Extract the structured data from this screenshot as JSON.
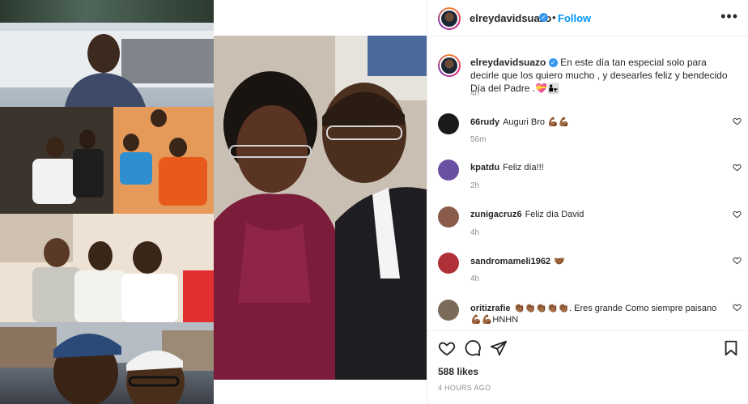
{
  "header": {
    "username": "elreydavidsuazo",
    "verified_badge": "✓",
    "separator": "•",
    "follow_label": "Follow",
    "more_icon": "•••"
  },
  "caption": {
    "username": "elreydavidsuazo",
    "text": "En este día tan especial solo para decirle que los quiero mucho , y desearles feliz y bendecido Día del Padre .💝👨‍👧",
    "time": "4h"
  },
  "comments": [
    {
      "username": "66rudy",
      "text": "Auguri Bro 💪🏾💪🏾",
      "time": "56m",
      "avatar_color": "#1a1a1a"
    },
    {
      "username": "kpatdu",
      "text": "Feliz día!!!",
      "time": "2h",
      "avatar_color": "#6b4fa3"
    },
    {
      "username": "zunigacruz6",
      "text": "Feliz día David",
      "time": "4h",
      "avatar_color": "#8a5a4a"
    },
    {
      "username": "sandromameli1962",
      "text": "🤝🏾",
      "time": "4h",
      "avatar_color": "#b0303a"
    },
    {
      "username": "oritizrafie",
      "text": "👏🏾👏🏾👏🏾👏🏾👏🏾. Eres grande Como siempre paisano 💪🏾💪🏾HNHN",
      "time": "",
      "avatar_color": "#7a6a5a"
    }
  ],
  "actions": {
    "likes": "588 likes",
    "post_time": "4 HOURS AGO"
  },
  "icons": {
    "like": "heart-icon",
    "comment": "comment-bubble-icon",
    "share": "paper-plane-icon",
    "save": "bookmark-icon",
    "comment_like": "small-heart-icon"
  }
}
